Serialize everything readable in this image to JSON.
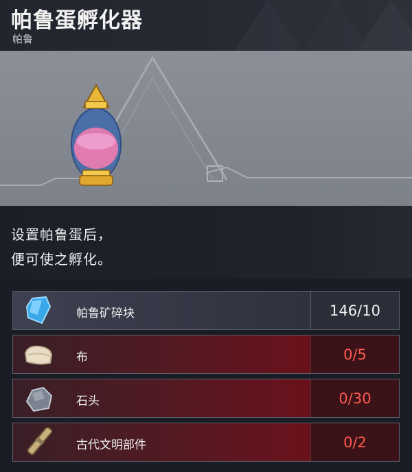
{
  "item": {
    "title": "帕鲁蛋孵化器",
    "category": "帕鲁",
    "description_line1": "设置帕鲁蛋后，",
    "description_line2": "便可使之孵化。"
  },
  "materials": [
    {
      "name": "帕鲁矿碎块",
      "count": "146/10",
      "icon": "crystal-icon",
      "status": "sufficient"
    },
    {
      "name": "布",
      "count": "0/5",
      "icon": "cloth-icon",
      "status": "insufficient"
    },
    {
      "name": "石头",
      "count": "0/30",
      "icon": "stone-icon",
      "status": "insufficient"
    },
    {
      "name": "古代文明部件",
      "count": "0/2",
      "icon": "ancient-part-icon",
      "status": "insufficient"
    }
  ],
  "colors": {
    "sufficient": "#f2f2f2",
    "insufficient": "#ff5a4f"
  }
}
